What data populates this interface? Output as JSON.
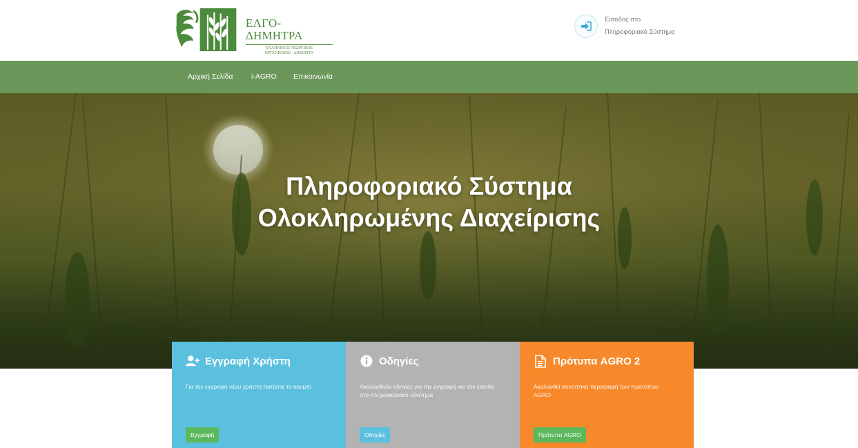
{
  "header": {
    "logo": {
      "title": "ΕΛΓΟ-ΔΗΜΗΤΡΑ",
      "subtitle_line1": "ΕΛΛΗΝΙΚΟΣ ΓΕΩΡΓΙΚΟΣ",
      "subtitle_line2": "ΟΡΓΑΝΙΣΜΟΣ - ΔΗΜΗΤΡΑ"
    },
    "login": {
      "line1": "Είσοδος στο",
      "line2": "Πληροφοριακό Σύστημα",
      "icon": "sign-in-icon"
    }
  },
  "nav": {
    "items": [
      "Αρχική Σελίδα",
      "i-AGRO",
      "Επικοινωνία"
    ]
  },
  "hero": {
    "title_line1": "Πληροφοριακό Σύστημα",
    "title_line2": "Ολοκληρωμένης Διαχείρισης"
  },
  "cards": [
    {
      "title": "Εγγραφή Χρήστη",
      "icon": "user-plus-icon",
      "description": "Για την εγγραφή νέου χρήστη πατήστε το κουμπί",
      "button": "Εγγραφή",
      "color": "#5bc0de",
      "button_color": "#5cb85c"
    },
    {
      "title": "Οδηγίες",
      "icon": "info-icon",
      "description": "Ακολουθούν οδηγίες για την εγγραφή και την είσοδο στο πληροφοριακό σύστημα",
      "button": "Οδηγίες",
      "color": "#b3b3b3",
      "button_color": "#5bc0de"
    },
    {
      "title": "Πρότυπα AGRO 2",
      "icon": "document-icon",
      "description": "Ακολουθεί συνοπτική περιγραφή των προτύπων AGRO",
      "button": "Πρότυπα AGRO",
      "color": "#f7892b",
      "button_color": "#5cb85c"
    }
  ],
  "colors": {
    "nav_green": "#6b975a",
    "brand_green": "#4c8a3c"
  }
}
